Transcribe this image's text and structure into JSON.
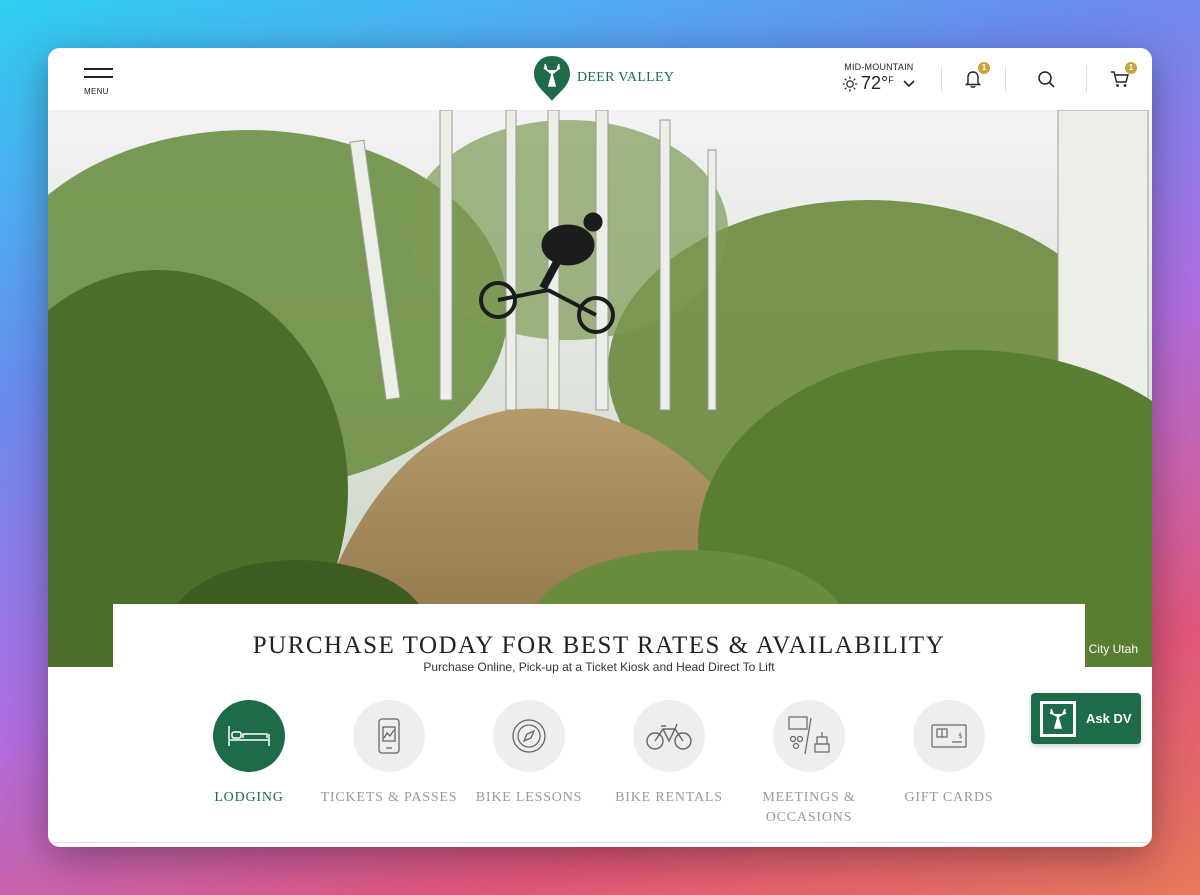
{
  "header": {
    "menu_label": "MENU",
    "logo_text": "DEER VALLEY",
    "weather": {
      "label": "MID-MOUNTAIN",
      "temp": "72°",
      "unit": "F",
      "icon": "sun-icon"
    },
    "notifications_count": "1",
    "cart_count": "1"
  },
  "hero": {
    "caption": "City Utah"
  },
  "panel": {
    "title": "PURCHASE TODAY FOR BEST RATES & AVAILABILITY",
    "subtitle": "Purchase Online, Pick-up at a Ticket Kiosk and Head Direct To Lift",
    "categories": [
      {
        "label": "LODGING",
        "icon": "bed-icon",
        "active": true
      },
      {
        "label": "TICKETS & PASSES",
        "icon": "phone-ticket-icon",
        "active": false
      },
      {
        "label": "BIKE LESSONS",
        "icon": "compass-icon",
        "active": false
      },
      {
        "label": "BIKE RENTALS",
        "icon": "bicycle-icon",
        "active": false
      },
      {
        "label": "MEETINGS & OCCASIONS",
        "icon": "meeting-cake-icon",
        "active": false
      },
      {
        "label": "GIFT CARDS",
        "icon": "gift-card-icon",
        "active": false
      }
    ]
  },
  "chat": {
    "label": "Ask DV"
  },
  "colors": {
    "brand_green": "#1e6b4a",
    "badge_gold": "#c9a43a"
  }
}
